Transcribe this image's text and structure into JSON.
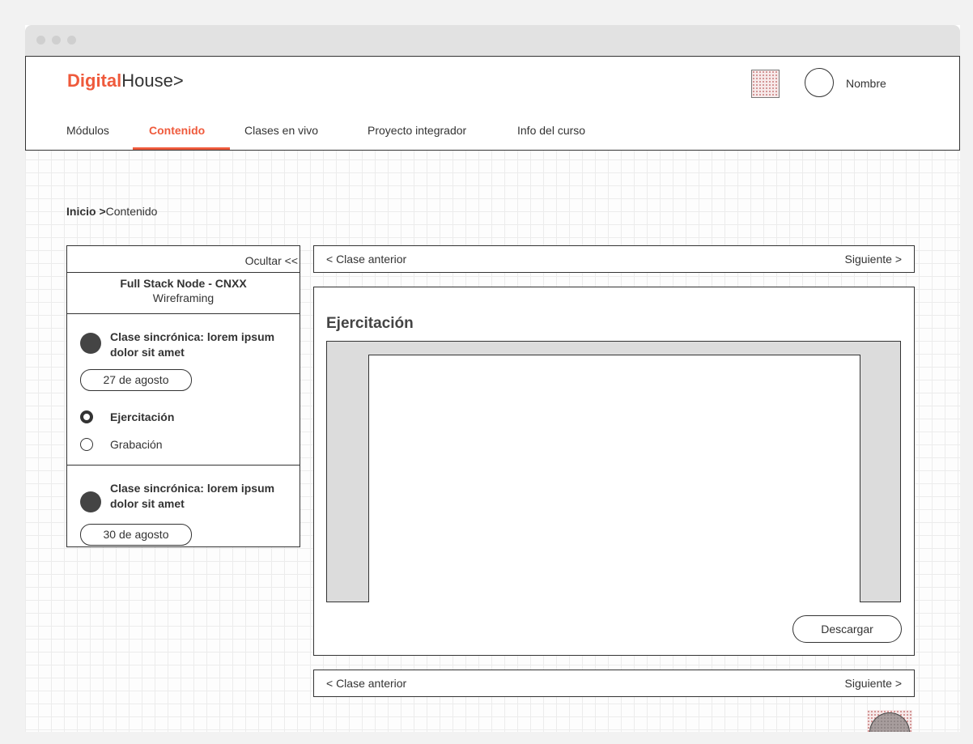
{
  "header": {
    "logo_brand": "Digital",
    "logo_rest": "House>",
    "user_name": "Nombre"
  },
  "nav": {
    "tabs": [
      {
        "label": "Módulos",
        "active": false
      },
      {
        "label": "Contenido",
        "active": true
      },
      {
        "label": "Clases en vivo",
        "active": false
      },
      {
        "label": "Proyecto integrador",
        "active": false
      },
      {
        "label": "Info del curso",
        "active": false
      }
    ]
  },
  "breadcrumb": {
    "home": "Inicio >",
    "current": "Contenido"
  },
  "sidebar": {
    "hide_label": "Ocultar <<",
    "course_title": "Full Stack Node - CNXX",
    "course_subtitle": "Wireframing",
    "classes": [
      {
        "title": "Clase sincrónica: lorem ipsum dolor sit amet",
        "date": "27 de agosto",
        "options": [
          {
            "label": "Ejercitación",
            "selected": true
          },
          {
            "label": "Grabación",
            "selected": false
          }
        ]
      },
      {
        "title": "Clase sincrónica: lorem ipsum dolor sit amet",
        "date": "30 de agosto"
      }
    ]
  },
  "pager": {
    "prev_label": "< Clase anterior",
    "next_label": "Siguiente >"
  },
  "main": {
    "title": "Ejercitación",
    "download_label": "Descargar"
  },
  "colors": {
    "accent": "#ef5a3c",
    "border": "#333333",
    "media_bg": "#dcdcdc"
  }
}
